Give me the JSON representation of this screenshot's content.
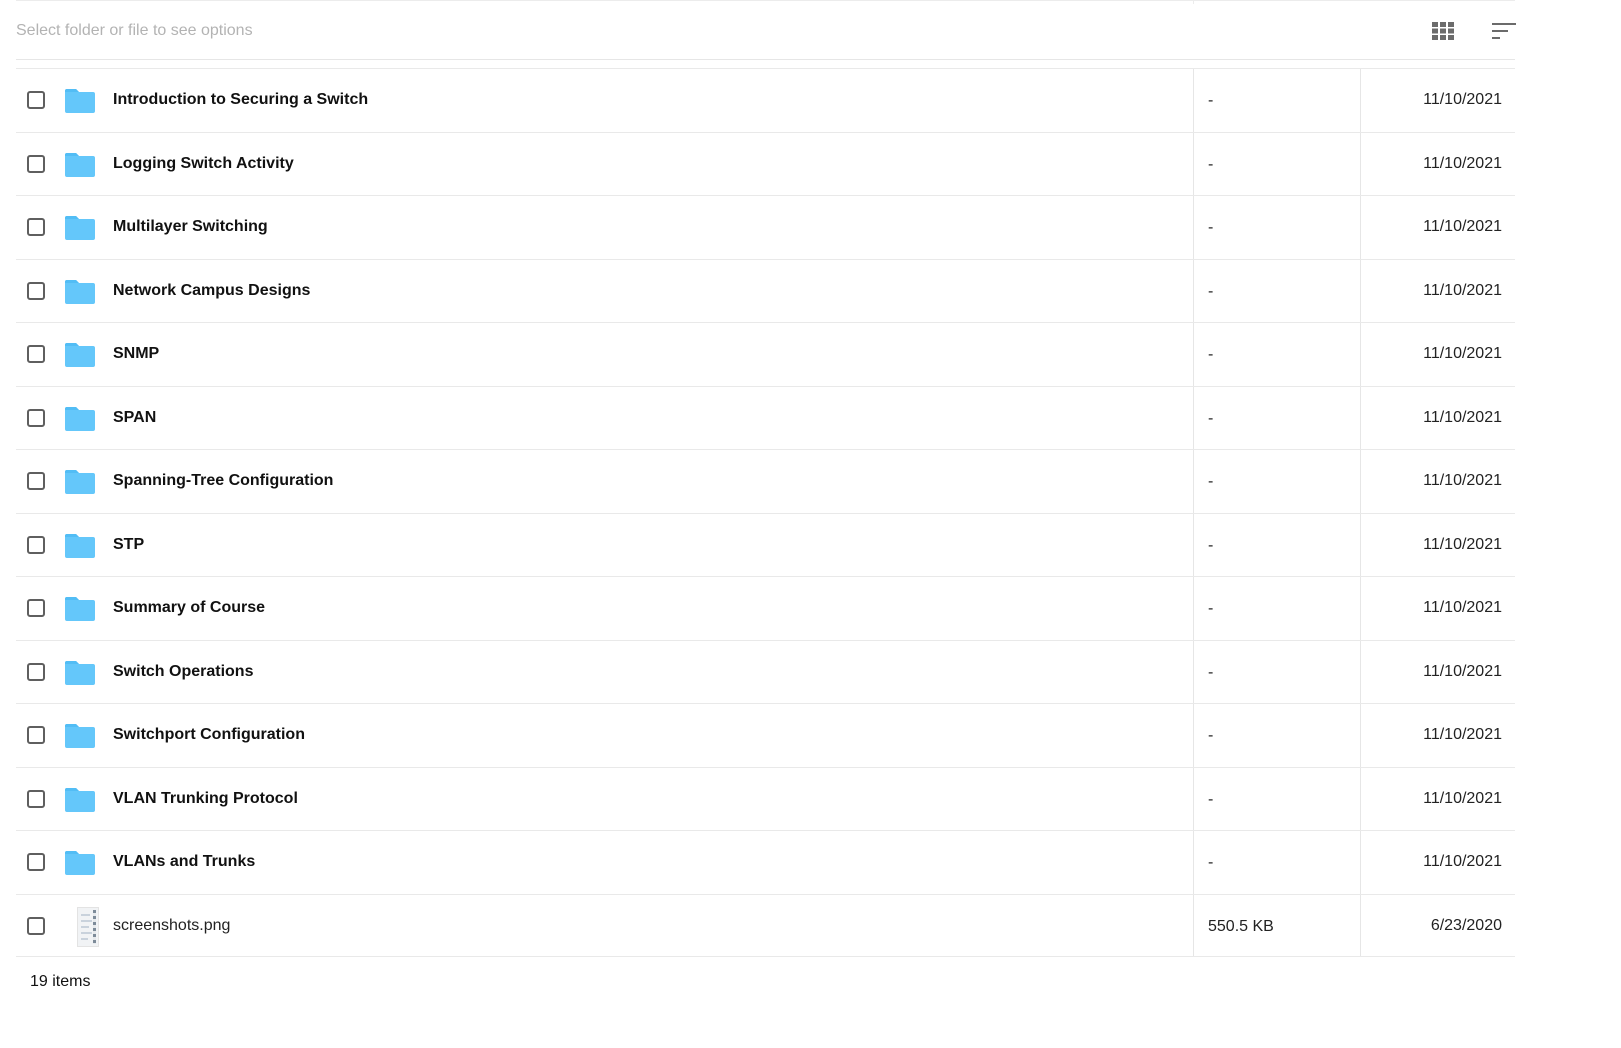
{
  "toolbar": {
    "hint": "Select folder or file to see options",
    "grid_icon": "grid-view-icon",
    "sort_icon": "sort-icon"
  },
  "colors": {
    "folder": "#64c7fa",
    "folder_tab": "#52bdf5"
  },
  "items": [
    {
      "name": "Introduction to Securing a Switch",
      "size": "-",
      "date": "11/10/2021",
      "type": "folder"
    },
    {
      "name": "Logging Switch Activity",
      "size": "-",
      "date": "11/10/2021",
      "type": "folder"
    },
    {
      "name": "Multilayer Switching",
      "size": "-",
      "date": "11/10/2021",
      "type": "folder"
    },
    {
      "name": "Network Campus Designs",
      "size": "-",
      "date": "11/10/2021",
      "type": "folder"
    },
    {
      "name": "SNMP",
      "size": "-",
      "date": "11/10/2021",
      "type": "folder"
    },
    {
      "name": "SPAN",
      "size": "-",
      "date": "11/10/2021",
      "type": "folder"
    },
    {
      "name": "Spanning-Tree Configuration",
      "size": "-",
      "date": "11/10/2021",
      "type": "folder"
    },
    {
      "name": "STP",
      "size": "-",
      "date": "11/10/2021",
      "type": "folder"
    },
    {
      "name": "Summary of Course",
      "size": "-",
      "date": "11/10/2021",
      "type": "folder"
    },
    {
      "name": "Switch Operations",
      "size": "-",
      "date": "11/10/2021",
      "type": "folder"
    },
    {
      "name": "Switchport Configuration",
      "size": "-",
      "date": "11/10/2021",
      "type": "folder"
    },
    {
      "name": "VLAN Trunking Protocol",
      "size": "-",
      "date": "11/10/2021",
      "type": "folder"
    },
    {
      "name": "VLANs and Trunks",
      "size": "-",
      "date": "11/10/2021",
      "type": "folder"
    },
    {
      "name": "screenshots.png",
      "size": "550.5 KB",
      "date": "6/23/2020",
      "type": "file"
    }
  ],
  "footer": {
    "count": "19 items"
  }
}
